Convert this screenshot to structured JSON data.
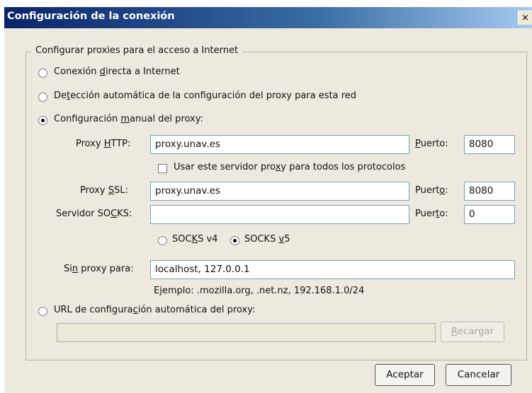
{
  "window": {
    "title": "Configuración de la conexión",
    "close_glyph": "×"
  },
  "group_label": "Configurar proxies para el acceso a Internet",
  "options": {
    "direct": {
      "pre": "Conexión ",
      "key": "d",
      "post": "irecta a Internet",
      "selected": false
    },
    "auto_detect": {
      "pre": "De",
      "key": "t",
      "post": "ección automática de la configuración del proxy para esta red",
      "selected": false
    },
    "manual": {
      "pre": "Configuración ",
      "key": "m",
      "post": "anual del proxy:",
      "selected": true
    },
    "auto_url": {
      "pre": "URL de configura",
      "key": "c",
      "post": "ión automática del proxy:",
      "selected": false
    }
  },
  "http": {
    "label_pre": "Proxy ",
    "label_key": "H",
    "label_post": "TTP:",
    "value": "proxy.unav.es",
    "port_key": "P",
    "port_post": "uerto:",
    "port": "8080"
  },
  "share": {
    "pre": "Usar este servidor pro",
    "key": "x",
    "post": "y para todos los protocolos",
    "checked": false
  },
  "ssl": {
    "label_pre": "Proxy ",
    "label_key": "S",
    "label_post": "SL:",
    "value": "proxy.unav.es",
    "port_pre": "Puert",
    "port_key": "o",
    "port_post": ":",
    "port": "8080"
  },
  "socks": {
    "label_pre": "Servidor SO",
    "label_key": "C",
    "label_post": "KS:",
    "value": "",
    "port_pre": "Puer",
    "port_key": "t",
    "port_post": "o:",
    "port": "0"
  },
  "socks_version": {
    "v4": {
      "pre": "SOC",
      "key": "K",
      "post": "S v4",
      "selected": false
    },
    "v5": {
      "pre": "SOCKS ",
      "key": "v",
      "post": "5",
      "selected": true
    }
  },
  "no_proxy": {
    "label_pre": "Si",
    "label_key": "n",
    "label_post": " proxy para:",
    "value": "localhost, 127.0.0.1",
    "example": "Ejemplo: .mozilla.org, .net.nz, 192.168.1.0/24"
  },
  "auto_url_value": "",
  "buttons": {
    "reload": {
      "key": "R",
      "post": "ecargar",
      "enabled": false
    },
    "ok": "Aceptar",
    "cancel": "Cancelar"
  }
}
